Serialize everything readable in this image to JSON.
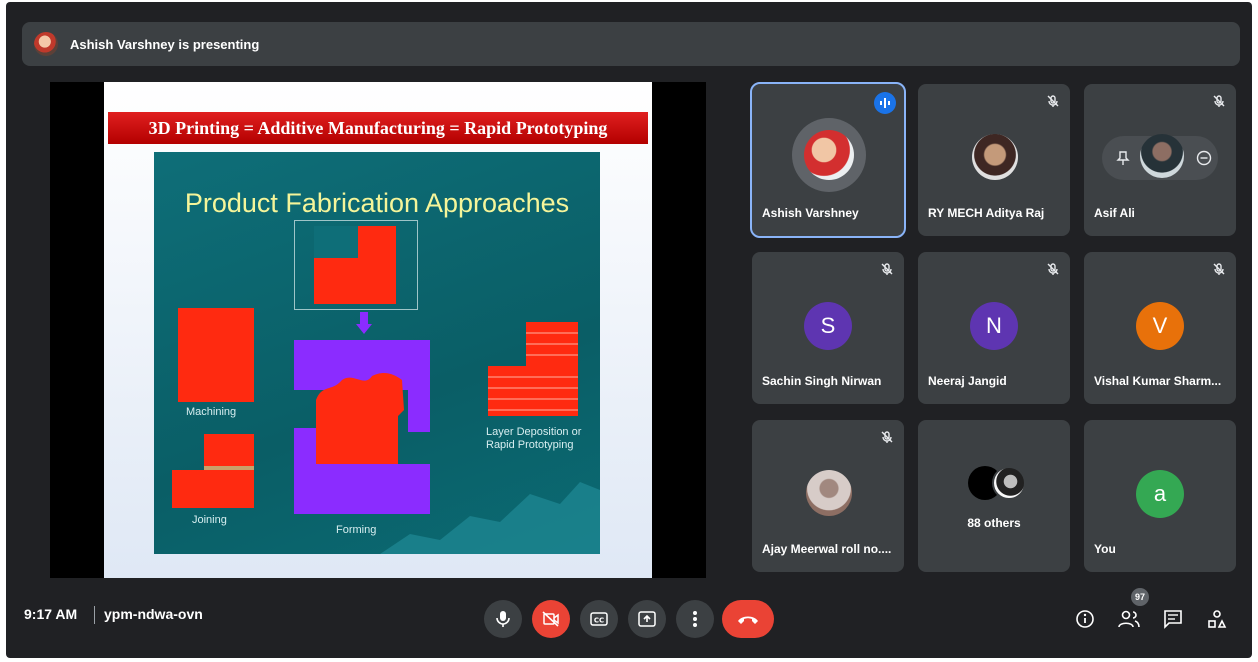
{
  "banner": {
    "presenting_text": "Ashish Varshney is presenting"
  },
  "slide": {
    "title": "3D Printing = Additive Manufacturing = Rapid Prototyping",
    "heading": "Product Fabrication Approaches",
    "captions": {
      "machining": "Machining",
      "joining": "Joining",
      "forming": "Forming",
      "layer": "Layer Deposition or Rapid Prototyping"
    }
  },
  "participants": [
    {
      "name": "Ashish Varshney",
      "avatar": "photo",
      "speaking": true
    },
    {
      "name": "RY MECH Aditya Raj",
      "avatar": "photo",
      "muted": true
    },
    {
      "name": "Asif Ali",
      "avatar": "photo",
      "muted": true
    },
    {
      "name": "Sachin Singh Nirwan",
      "letter": "S",
      "color": "#5e35b1",
      "muted": true
    },
    {
      "name": "Neeraj Jangid",
      "letter": "N",
      "color": "#5e35b1",
      "muted": true
    },
    {
      "name": "Vishal Kumar Sharm...",
      "letter": "V",
      "color": "#e8710a",
      "muted": true
    },
    {
      "name": "Ajay Meerwal roll no....",
      "avatar": "photo",
      "muted": true
    },
    {
      "name": "88 others",
      "avatar": "group"
    },
    {
      "name": "You",
      "letter": "a",
      "color": "#34a853"
    }
  ],
  "bottom": {
    "time": "9:17 AM",
    "meeting_code": "ypm-ndwa-ovn",
    "people_count": "97"
  },
  "colors": {
    "accent": "#1a73e8",
    "danger": "#ea4335",
    "tile": "#3c4043",
    "background": "#202124"
  }
}
